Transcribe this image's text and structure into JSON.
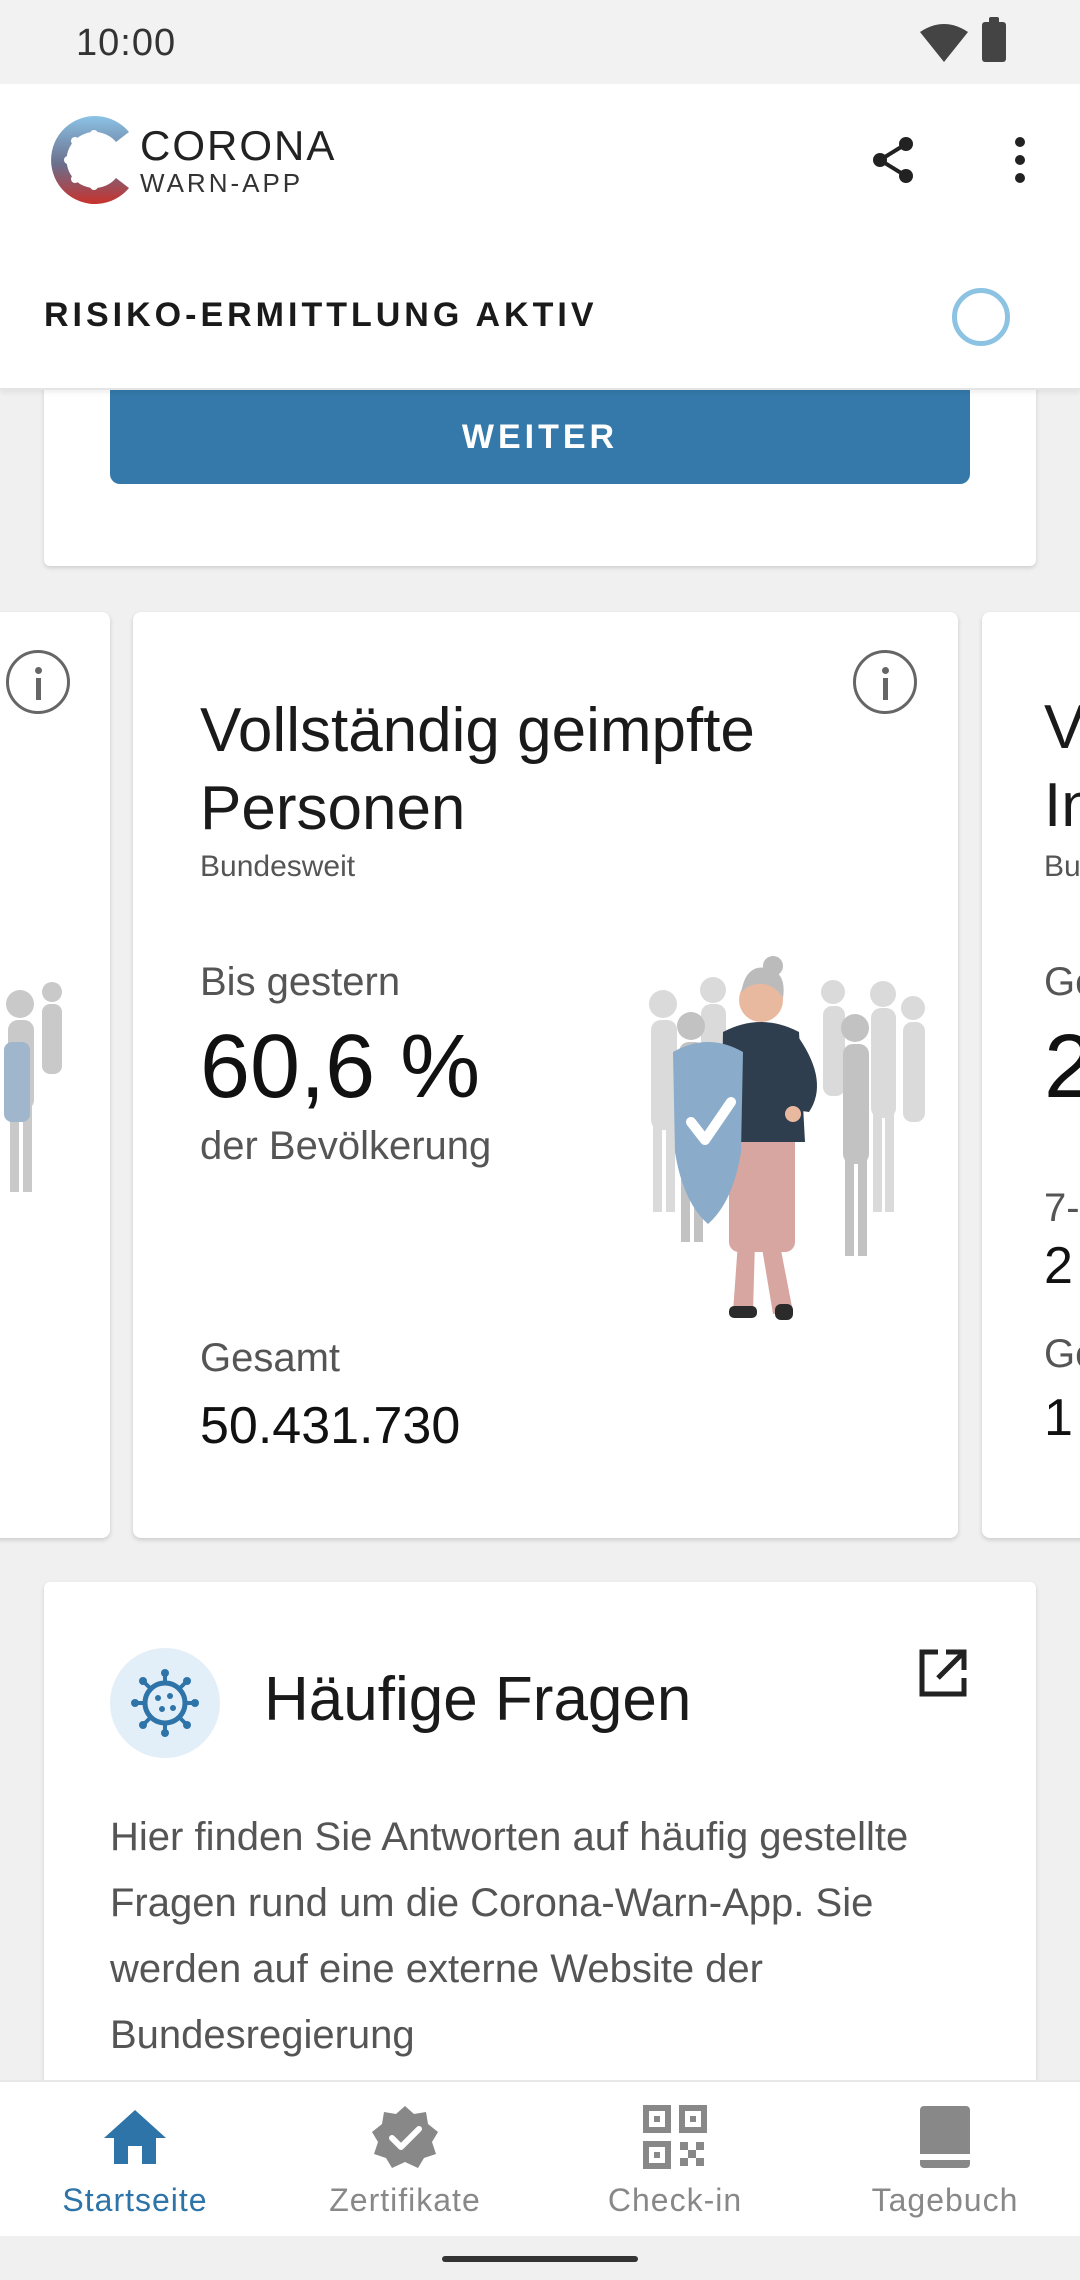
{
  "status_bar": {
    "time": "10:00"
  },
  "app": {
    "brand_title": "CORONA",
    "brand_subtitle": "WARN-APP"
  },
  "risk": {
    "label": "RISIKO-ERMITTLUNG AKTIV"
  },
  "top_card": {
    "button_label": "WEITER"
  },
  "stats": {
    "main": {
      "title": "Vollständig geimpfte Personen",
      "scope": "Bundesweit",
      "period": "Bis gestern",
      "value": "60,6 %",
      "unit": "der Bevölkerung",
      "total_label": "Gesamt",
      "total_value": "50.431.730"
    },
    "right_peek": {
      "title_line1": "V",
      "title_line2": "In",
      "scope": "Bu",
      "line_a": "Ge",
      "value_big": "2",
      "line_b": "7-",
      "line_c": "2",
      "line_d": "Ge",
      "line_e": "1"
    }
  },
  "faq": {
    "title": "Häufige Fragen",
    "body": "Hier finden Sie Antworten auf häufig gestellte Fragen rund um die Corona-Warn-App. Sie werden auf eine externe Website der Bundesregierung"
  },
  "bottom_nav": {
    "items": [
      {
        "label": "Startseite",
        "icon": "home-icon",
        "active": true
      },
      {
        "label": "Zertifikate",
        "icon": "certificate-icon",
        "active": false
      },
      {
        "label": "Check-in",
        "icon": "qr-code-icon",
        "active": false
      },
      {
        "label": "Tagebuch",
        "icon": "book-icon",
        "active": false
      }
    ]
  },
  "colors": {
    "primary": "#2e74a8",
    "button": "#3479a9",
    "ring": "#8cc3e2",
    "faq_badge": "#e3eff8"
  }
}
